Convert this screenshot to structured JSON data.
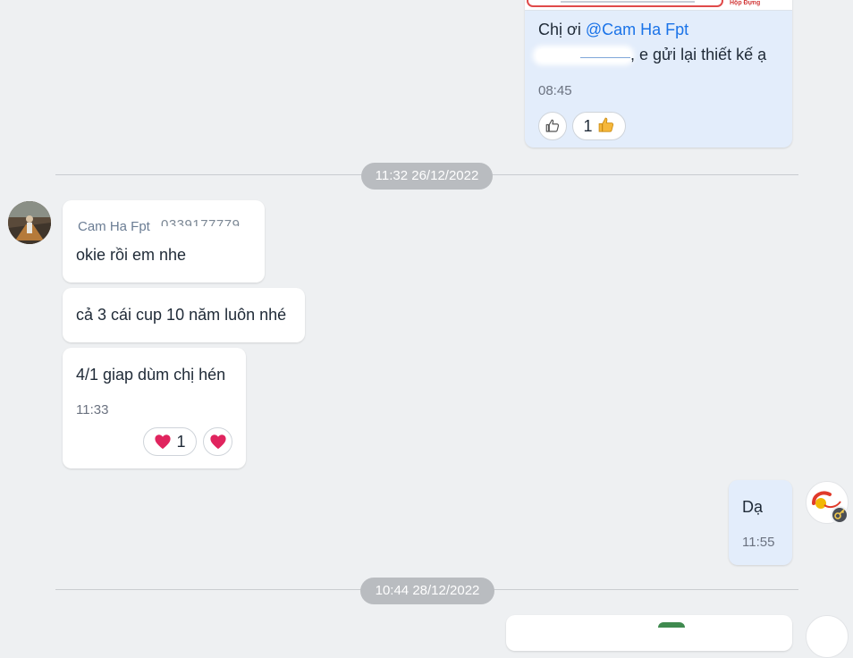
{
  "messages": [
    {
      "id": "m1",
      "text_prefix": "Chị ơi ",
      "mention": "@Cam Ha Fpt",
      "text_suffix": ", e gửi lại thiết kế ạ",
      "time": "08:45",
      "image_caption": "Hộp Đựng",
      "reactions": [
        {
          "icon": "thumbs-up-outline-icon",
          "count": ""
        },
        {
          "icon": "thumbs-up-emoji",
          "count": "1"
        }
      ]
    },
    {
      "id": "m2",
      "sender": "Cam Ha Fpt",
      "sender_phone_partial": "0339177779",
      "text": "okie rồi em nhe"
    },
    {
      "id": "m3",
      "text": "cả 3 cái cup 10 năm luôn nhé"
    },
    {
      "id": "m4",
      "text": "4/1 giap dùm chị hén",
      "time": "11:33",
      "reactions": [
        {
          "icon": "heart-emoji",
          "count": "1"
        },
        {
          "icon": "heart-emoji",
          "count": ""
        }
      ]
    },
    {
      "id": "m5",
      "text": "Dạ",
      "time": "11:55"
    }
  ],
  "dividers": [
    {
      "label": "11:32 26/12/2022"
    },
    {
      "label": "10:44 28/12/2022"
    }
  ],
  "colors": {
    "background": "#eef0f2",
    "incoming_bubble": "#ffffff",
    "outgoing_bubble": "#e3edfb",
    "mention": "#1a73e8",
    "heart": "#e0245e"
  }
}
